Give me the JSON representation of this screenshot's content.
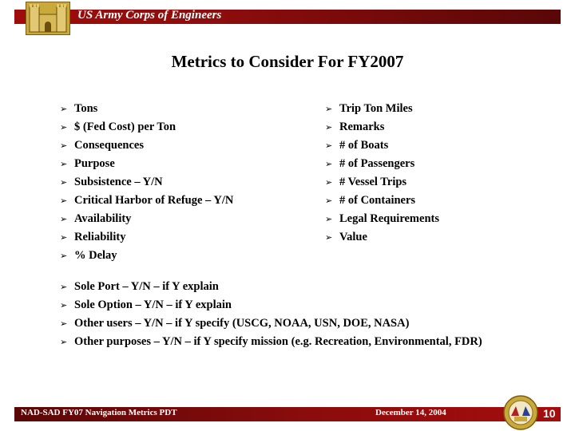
{
  "header": {
    "org_name": "US Army Corps of Engineers",
    "logo_icon": "castle-icon",
    "bar_color": "#8c0c0c"
  },
  "title": "Metrics to Consider For FY2007",
  "bullet_icon": "arrow-bullet-icon",
  "bullet_glyph": "➢",
  "left_list": [
    "Tons",
    "$ (Fed Cost) per Ton",
    "Consequences",
    "Purpose",
    "Subsistence – Y/N",
    "Critical Harbor of Refuge – Y/N",
    "Availability",
    "Reliability",
    "% Delay"
  ],
  "right_list": [
    "Trip Ton Miles",
    "Remarks",
    "# of Boats",
    "# of Passengers",
    "# Vessel Trips",
    "# of Containers",
    "Legal Requirements",
    "Value"
  ],
  "bottom_list": [
    "Sole Port – Y/N – if Y explain",
    "Sole Option – Y/N – if Y explain",
    "Other users – Y/N – if Y specify (USCG, NOAA, USN, DOE, NASA)",
    "Other purposes – Y/N – if Y specify mission (e.g. Recreation, Environmental, FDR)"
  ],
  "footer": {
    "left_text": "NAD-SAD FY07 Navigation Metrics PDT",
    "date": "December 14, 2004",
    "seal_icon": "army-seal-icon",
    "page_number": "10"
  }
}
